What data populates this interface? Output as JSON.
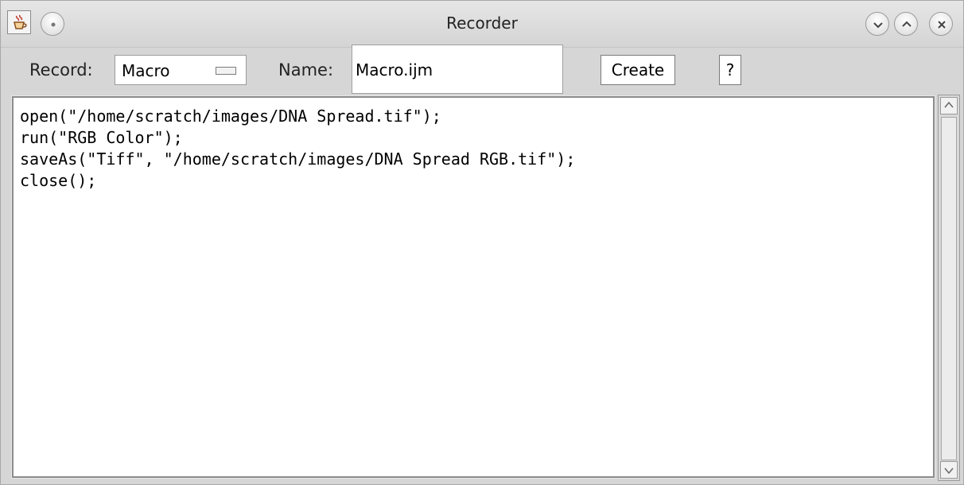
{
  "window": {
    "title": "Recorder",
    "controls": [
      "minimize",
      "maximize",
      "close"
    ]
  },
  "toolbar": {
    "record_label": "Record:",
    "record_value": "Macro",
    "name_label": "Name:",
    "name_value": "Macro.ijm",
    "create_label": "Create",
    "help_label": "?"
  },
  "editor": {
    "lines": [
      "open(\"/home/scratch/images/DNA Spread.tif\");",
      "run(\"RGB Color\");",
      "saveAs(\"Tiff\", \"/home/scratch/images/DNA Spread RGB.tif\");",
      "close();"
    ]
  },
  "icons": {
    "app": "java-cup-icon",
    "window_menu": "circle-dot-icon",
    "minimize": "chevron-down-icon",
    "maximize": "chevron-up-icon",
    "close": "close-icon",
    "scroll_up": "arrow-up-icon",
    "scroll_down": "arrow-down-icon"
  }
}
